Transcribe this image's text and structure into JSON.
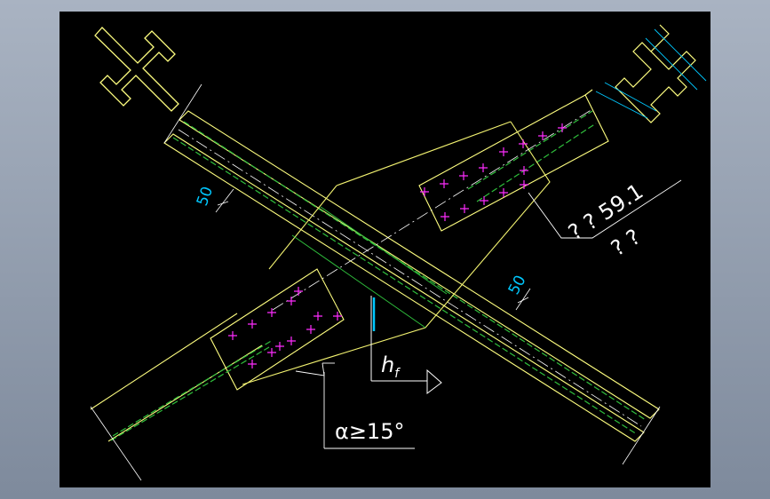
{
  "colors": {
    "background": "#000000",
    "frame": "#a9b3c2",
    "outline": "#ffff80",
    "gusset": "#f2f270",
    "weld": "#2fbf3c",
    "bolt": "#ff2cff",
    "dimension": "#00c8ff",
    "text": "#ffffff"
  },
  "labels": {
    "dim_left": "50",
    "dim_right": "50",
    "leader_line1": "? ? 59.1",
    "leader_line2": "? ?",
    "angle": "α≥15°",
    "weld_h": "h",
    "weld_sub": "f"
  },
  "icons": [
    "i-beam-section-icon",
    "i-beam-section-bolted-icon",
    "weld-symbol-arrow-icon"
  ]
}
